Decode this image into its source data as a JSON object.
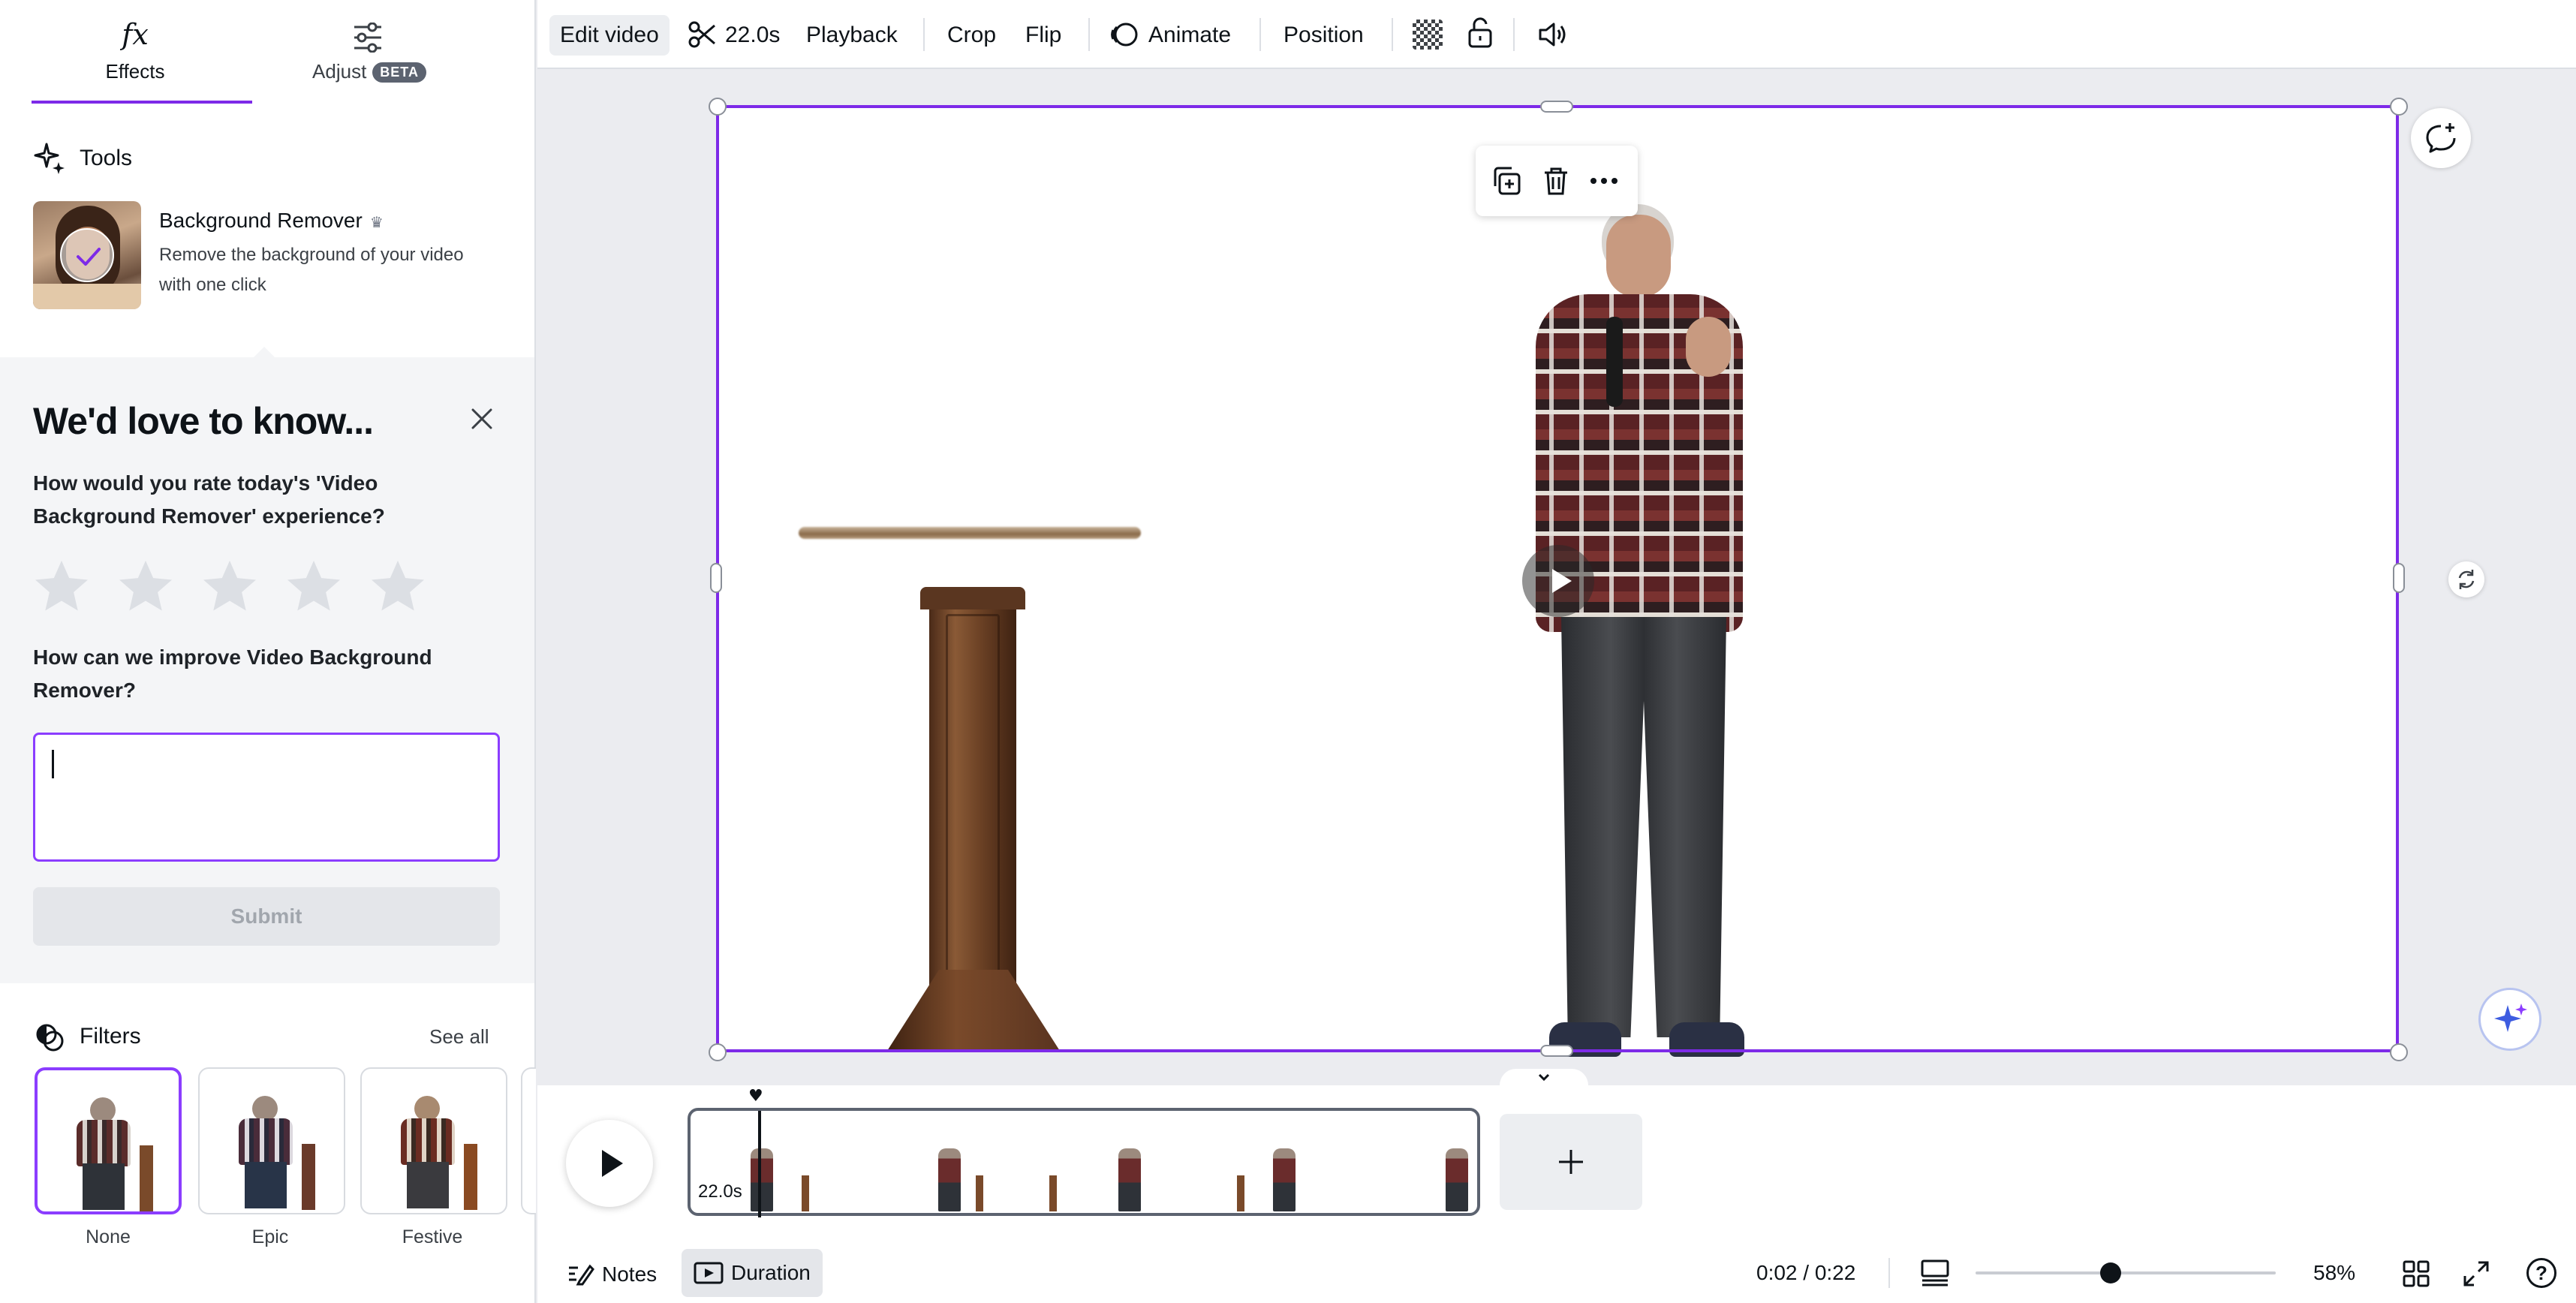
{
  "left_panel": {
    "tabs": [
      {
        "label": "Effects",
        "icon": "fx-icon",
        "active": true
      },
      {
        "label": "Adjust",
        "icon": "sliders-icon",
        "badge": "BETA"
      }
    ],
    "tools": {
      "heading": "Tools",
      "background_remover": {
        "title": "Background Remover",
        "desc_line1": "Remove the background of your video",
        "desc_line2": "with one click"
      }
    },
    "survey": {
      "title": "We'd love to know...",
      "q1_line1": "How would you rate today's 'Video",
      "q1_line2": "Background Remover' experience?",
      "stars": 5,
      "q2_line1": "How can we improve Video Background",
      "q2_line2": "Remover?",
      "input_value": "",
      "submit_label": "Submit"
    },
    "filters": {
      "heading": "Filters",
      "see_all": "See all",
      "items": [
        "None",
        "Epic",
        "Festive"
      ]
    }
  },
  "toolbar": {
    "edit_video": "Edit video",
    "trim_duration": "22.0s",
    "playback": "Playback",
    "crop": "Crop",
    "flip": "Flip",
    "animate": "Animate",
    "position": "Position"
  },
  "timeline": {
    "clip_duration": "22.0s",
    "playhead_fraction": 0.09
  },
  "footer": {
    "notes": "Notes",
    "duration": "Duration",
    "time": "0:02 / 0:22",
    "zoom": "58%",
    "zoom_fraction": 0.45
  },
  "colors": {
    "accent": "#8b3dff",
    "selection": "#7d2ae8",
    "text": "#0e1318"
  }
}
